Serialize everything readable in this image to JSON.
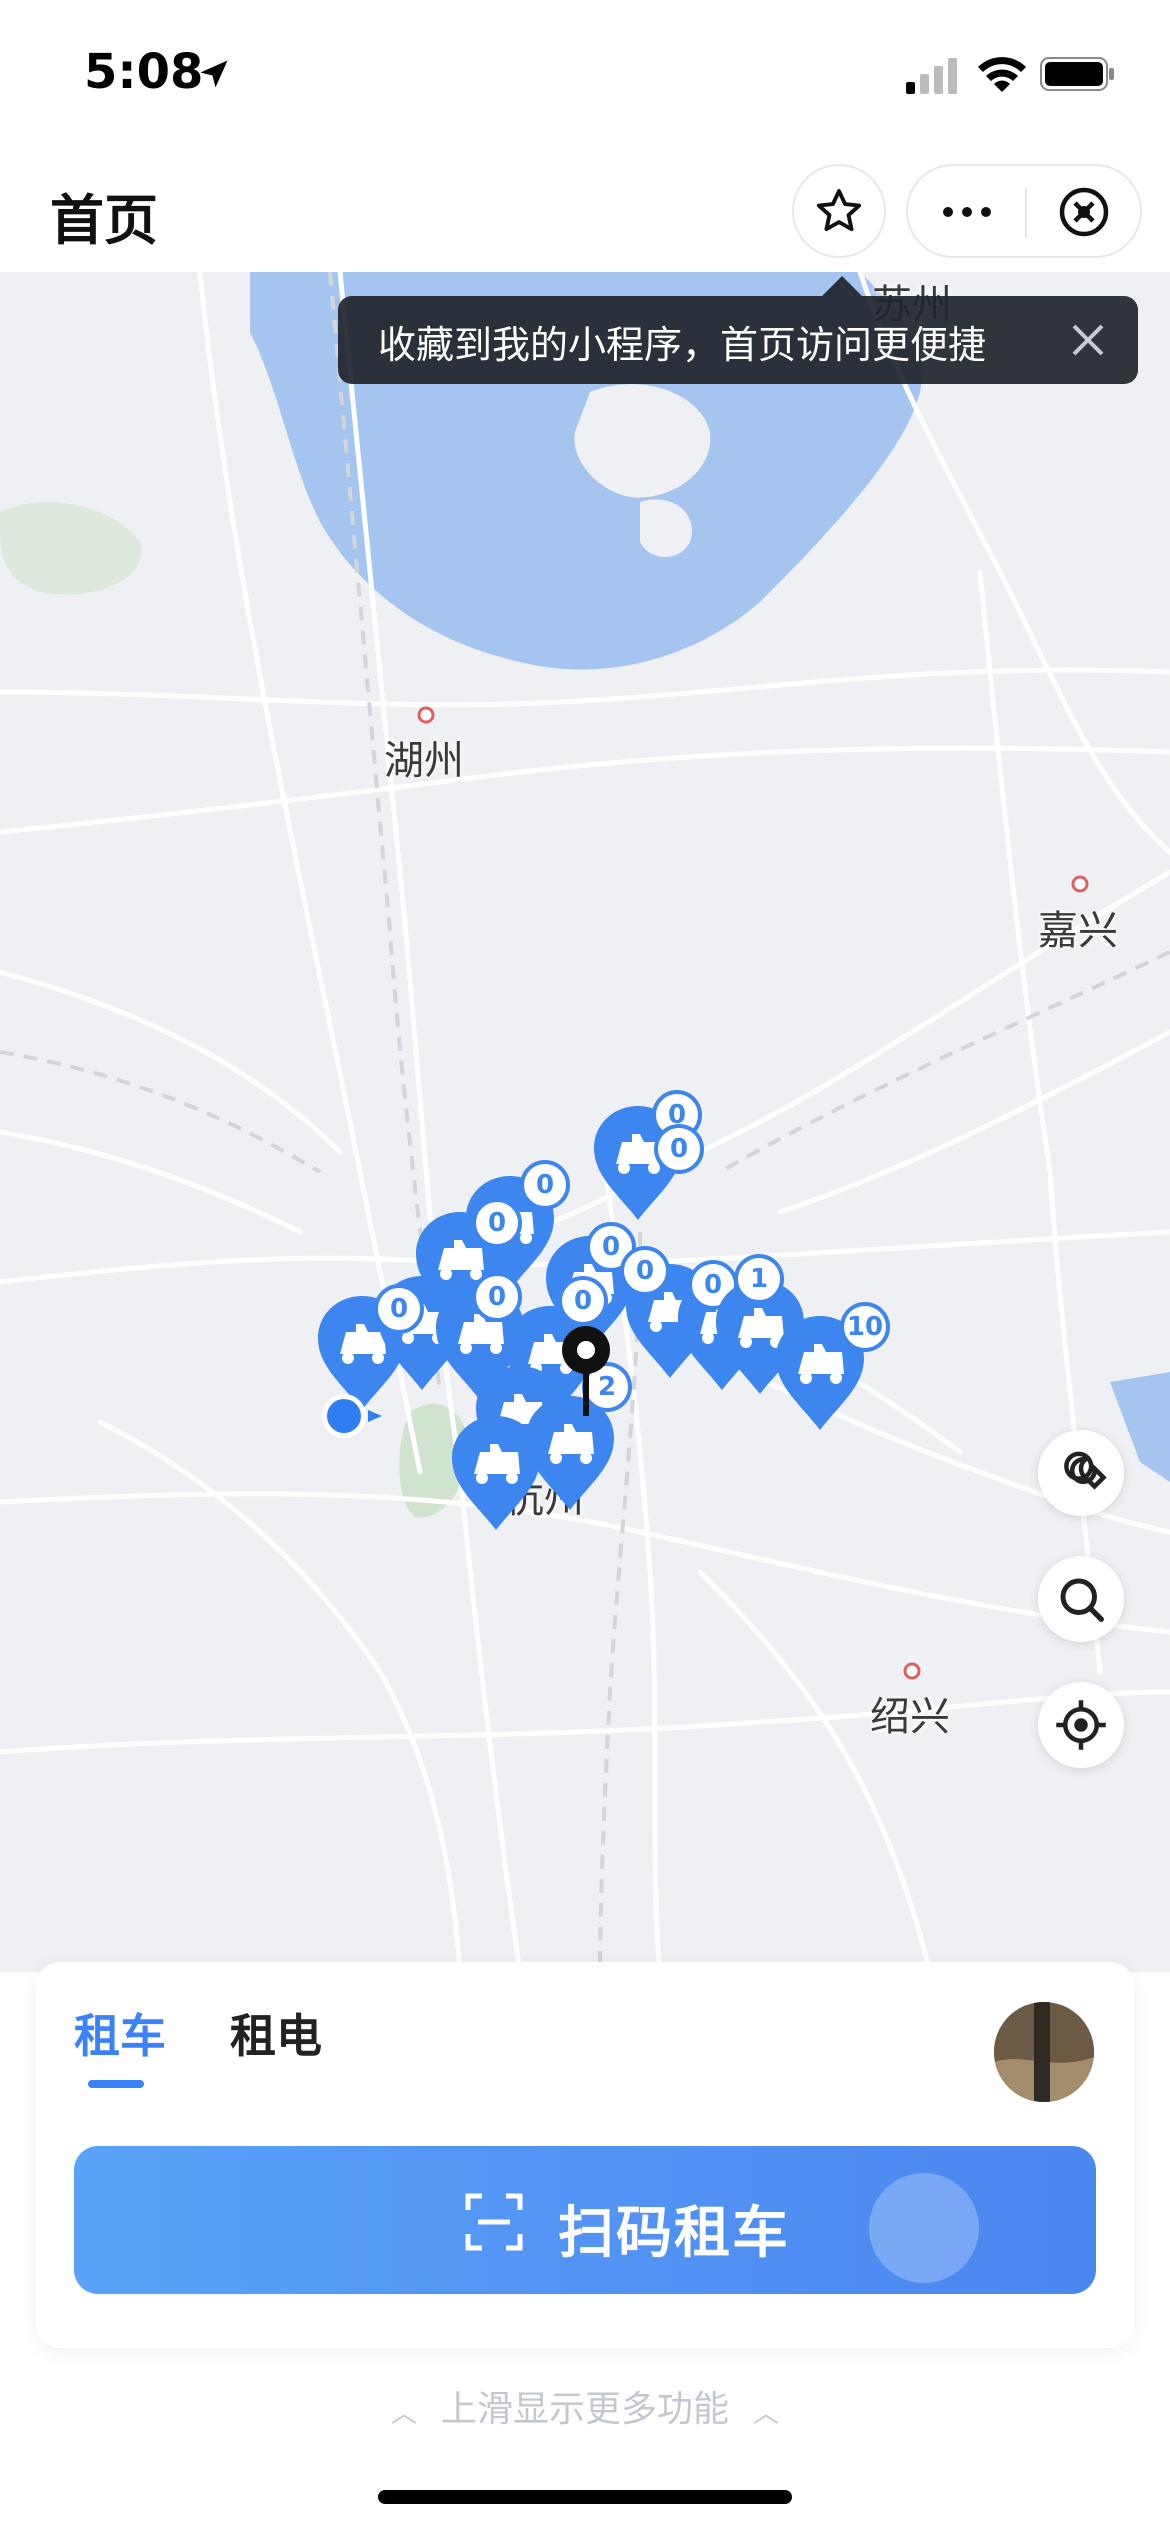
{
  "status_bar": {
    "time": "5:08"
  },
  "nav": {
    "title": "首页"
  },
  "tooltip": {
    "text": "收藏到我的小程序，首页访问更便捷"
  },
  "map": {
    "cities": {
      "suzhou": "苏州",
      "huzhou": "湖州",
      "jiaxing": "嘉兴",
      "hangzhou": "杭州",
      "shaoxing": "绍兴"
    },
    "badges": {
      "b1": "0",
      "b2": "0",
      "b3": "0",
      "b4": "0",
      "b5": "0",
      "b6": "0",
      "b7": "0",
      "b8": "0",
      "b9": "0",
      "b10": "1",
      "b11": "10",
      "b12": "2",
      "b13": "0"
    }
  },
  "card": {
    "tabs": [
      "租车",
      "租电"
    ],
    "scan_label": "扫码租车"
  },
  "hint": "上滑显示更多功能"
}
